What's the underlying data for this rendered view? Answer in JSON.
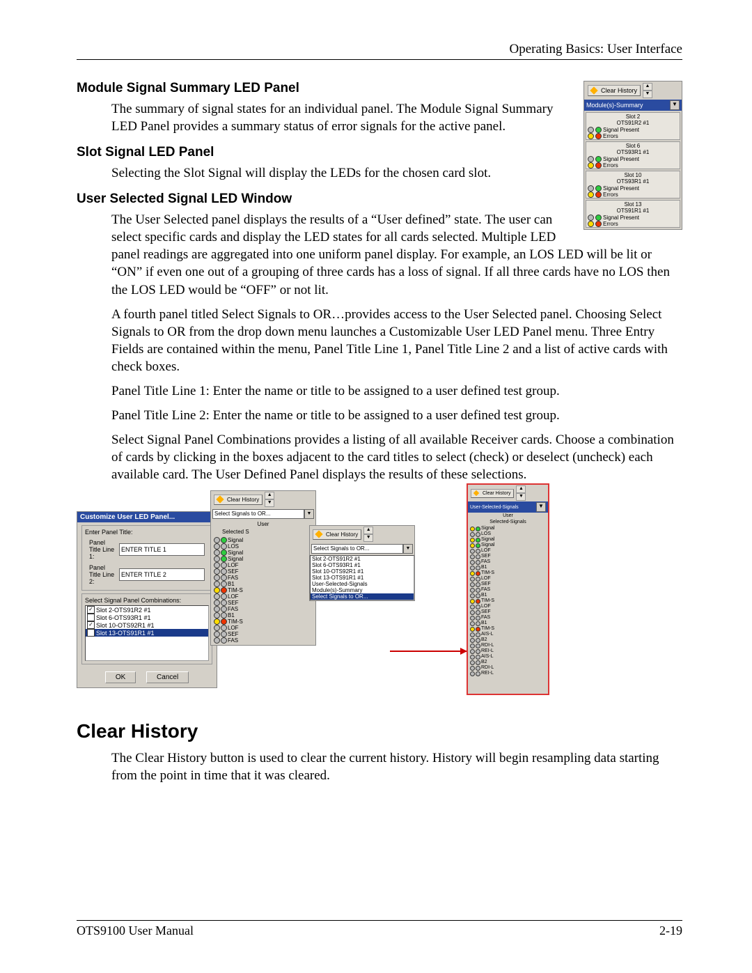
{
  "header": {
    "right": "Operating Basics: User Interface"
  },
  "sidepanel": {
    "clear_history": "Clear History",
    "modules_header": "Module(s)-Summary",
    "slots": [
      {
        "title1": "Slot 2",
        "title2": "OTS91R2 #1",
        "sp": "Signal Present",
        "er": "Errors"
      },
      {
        "title1": "Slot 6",
        "title2": "OTS93R1 #1",
        "sp": "Signal Present",
        "er": "Errors"
      },
      {
        "title1": "Slot 10",
        "title2": "OTS93R1 #1",
        "sp": "Signal Present",
        "er": "Errors"
      },
      {
        "title1": "Slot 13",
        "title2": "OTS91R1 #1",
        "sp": "Signal Present",
        "er": "Errors"
      }
    ]
  },
  "sections": {
    "s1_h": "Module Signal Summary LED Panel",
    "s1_p": "The summary of signal states for an individual panel. The Module Signal Summary LED Panel provides a summary status of error signals for the active panel.",
    "s2_h": "Slot Signal LED Panel",
    "s2_p": "Selecting the Slot Signal will display the LEDs for the chosen card slot.",
    "s3_h": "User Selected Signal LED Window",
    "s3_p1": "The User Selected panel displays the results of a “User defined” state. The user can select specific cards and display the LED states for all cards selected. Multiple LED panel readings are aggregated into one uniform panel display. For example, an LOS LED will be lit or “ON” if even one out of a grouping of three cards has a loss of signal. If all three cards have no LOS then the LOS LED would be “OFF” or not lit.",
    "s3_p2": "A fourth panel titled Select Signals to OR…provides access to the User Selected panel. Choosing Select Signals to OR from the drop down menu launches a Customizable User LED Panel menu. Three Entry Fields are contained within the menu, Panel Title Line 1, Panel Title Line 2 and a list of active cards with check boxes.",
    "s3_p3": "Panel Title Line 1: Enter the name or title to be assigned to a user defined test group.",
    "s3_p4": "Panel Title Line 2: Enter the name or title to be assigned to a user defined test group.",
    "s3_p5": "Select Signal Panel Combinations provides a listing of all available Receiver cards. Choose a combination of cards by clicking in the boxes adjacent to the card titles to select (check) or deselect (uncheck) each available card. The User Defined Panel displays the results of these selections."
  },
  "dialogA": {
    "title": "Customize User LED Panel...",
    "fieldset1": "Enter Panel Title:",
    "l1": "Panel Title Line 1:",
    "v1": "ENTER TITLE 1",
    "l2": "Panel Title Line 2:",
    "v2": "ENTER TITLE 2",
    "fieldset2": "Select Signal Panel Combinations:",
    "items": [
      {
        "chk": true,
        "label": "Slot 2-OTS91R2 #1"
      },
      {
        "chk": false,
        "label": "Slot 6-OTS93R1 #1"
      },
      {
        "chk": true,
        "label": "Slot 10-OTS92R1 #1"
      },
      {
        "chk": false,
        "label": "Slot 13-OTS91R1 #1",
        "sel": true
      }
    ],
    "ok": "OK",
    "cancel": "Cancel"
  },
  "panelB": {
    "ch": "Clear History",
    "combo": "Select Signals to OR...",
    "heading1": "User",
    "heading2": "Selected S",
    "leds": [
      "Signal",
      "LOS",
      "Signal",
      "Signal",
      "LOF",
      "SEF",
      "FAS",
      "B1",
      "TIM-S",
      "LOF",
      "SEF",
      "FAS",
      "B1",
      "TIM-S",
      "LOF",
      "SEF",
      "FAS"
    ]
  },
  "panelC": {
    "ch": "Clear History",
    "combo": "Select Signals to OR...",
    "items": [
      "Slot 2-OTS91R2 #1",
      "Slot 6-OTS93R1 #1",
      "Slot 10-OTS92R1 #1",
      "Slot 13-OTS91R1 #1",
      "User-Selected-Signals",
      "Module(s)-Summary",
      "Select Signals to OR..."
    ]
  },
  "panelD": {
    "ch": "Clear History",
    "hdr": "User-Selected-Signals",
    "t1": "User",
    "t2": "Selected-Signals",
    "leds": [
      "Signal",
      "LOS",
      "Signal",
      "Signal",
      "LOF",
      "SEF",
      "FAS",
      "B1",
      "TIM-S",
      "LOF",
      "SEF",
      "FAS",
      "B1",
      "TIM-S",
      "LOF",
      "SEF",
      "FAS",
      "B1",
      "TIM-S",
      "AIS-L",
      "B2",
      "RDI-L",
      "REI-L",
      "AIS-L",
      "B2",
      "RDI-L",
      "REI-L"
    ]
  },
  "clearhist": {
    "h": "Clear History",
    "p": "The Clear History button is used to clear the current history. History will begin resampling data starting from the point in time that it was cleared."
  },
  "footer": {
    "left": "OTS9100 User Manual",
    "right": "2-19"
  }
}
